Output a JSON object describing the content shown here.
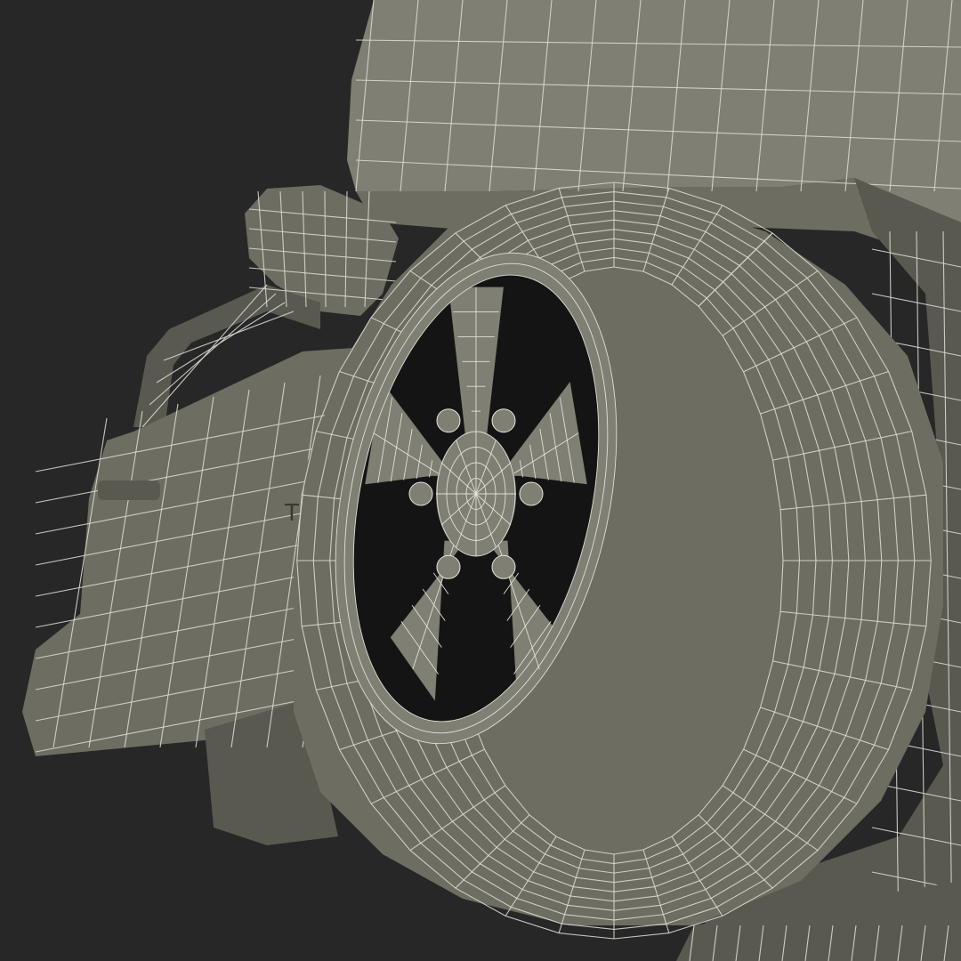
{
  "scene": {
    "subject": "truck-front-wheel-wireframe",
    "background_color": "#272727",
    "surface_color": "#6e6d62",
    "wire_color": "#d9d8cf"
  },
  "badge_text": "TA",
  "wheel": {
    "spoke_count": 5,
    "lug_count": 6
  },
  "tire": {
    "tread_rings": 9
  }
}
